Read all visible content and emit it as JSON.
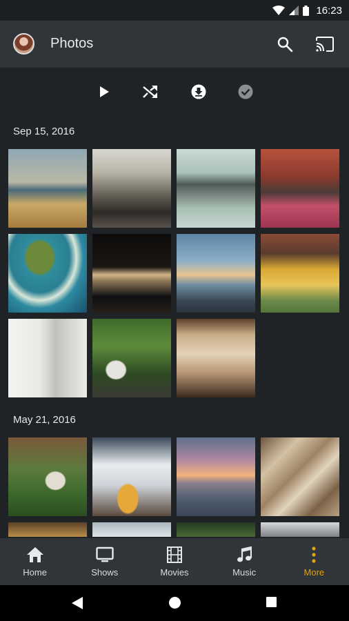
{
  "status": {
    "time": "16:23"
  },
  "header": {
    "title": "Photos"
  },
  "sections": [
    {
      "date": "Sep 15, 2016"
    },
    {
      "date": "May 21, 2016"
    }
  ],
  "nav": {
    "items": [
      {
        "label": "Home"
      },
      {
        "label": "Shows"
      },
      {
        "label": "Movies"
      },
      {
        "label": "Music"
      },
      {
        "label": "More"
      }
    ]
  },
  "colors": {
    "accent": "#e5a00d",
    "app_bar": "#30353a",
    "background": "#1f2326"
  }
}
